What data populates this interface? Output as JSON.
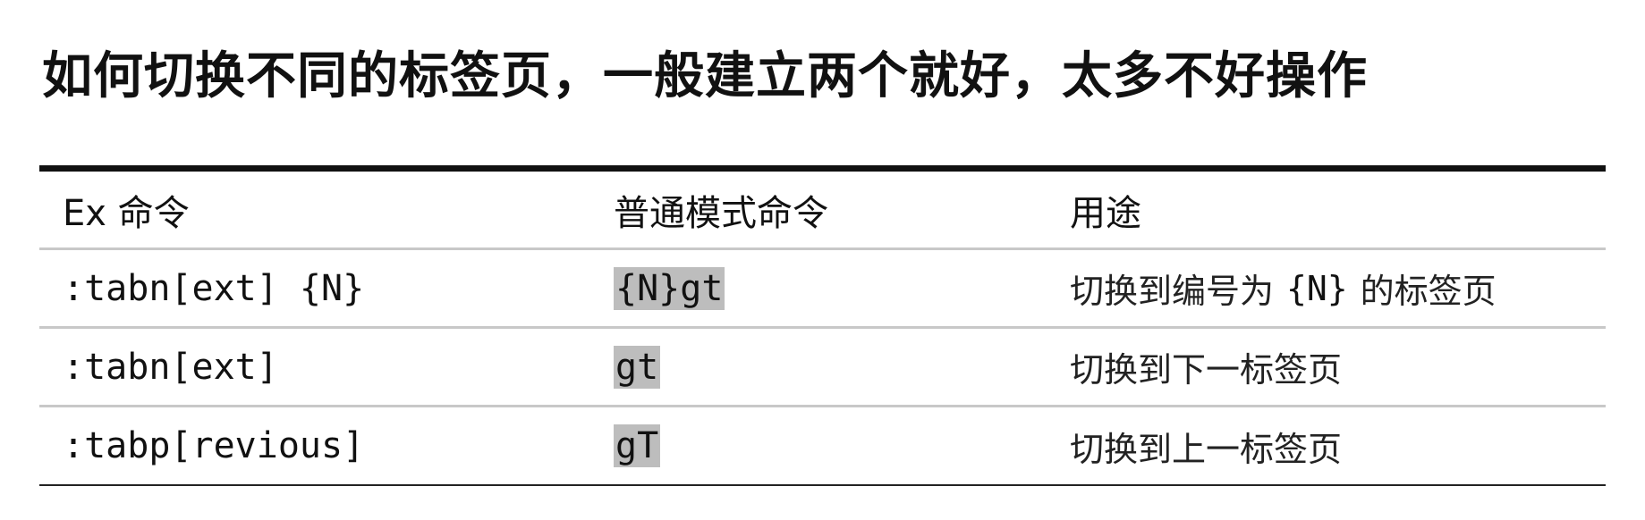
{
  "title": "如何切换不同的标签页，一般建立两个就好，太多不好操作",
  "table": {
    "headers": {
      "ex": "Ex 命令",
      "normal": "普通模式命令",
      "use": "用途"
    },
    "rows": [
      {
        "ex": ":tabn[ext] {N}",
        "normal": "{N}gt",
        "use_before": "切换到编号为",
        "use_code": "{N}",
        "use_after": "的标签页"
      },
      {
        "ex": ":tabn[ext]",
        "normal": "gt",
        "use": "切换到下一标签页"
      },
      {
        "ex": ":tabp[revious]",
        "normal": "gT",
        "use": "切换到上一标签页"
      }
    ]
  }
}
